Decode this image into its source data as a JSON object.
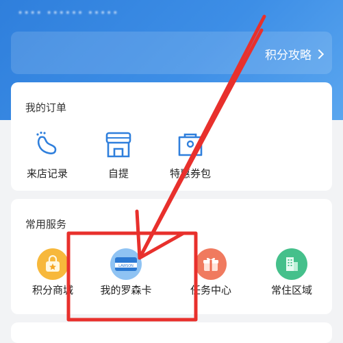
{
  "header": {
    "status_text": "•••• •••••• •••••",
    "points_link": "积分攻略"
  },
  "orders": {
    "title": "我的订单",
    "items": [
      {
        "label": "来店记录",
        "icon": "footprint-icon"
      },
      {
        "label": "自提",
        "icon": "store-icon"
      },
      {
        "label": "特惠券包",
        "icon": "coupon-bag-icon"
      }
    ]
  },
  "services": {
    "title": "常用服务",
    "items": [
      {
        "label": "积分商城",
        "icon": "shopping-bag-icon",
        "color": "#f5a623"
      },
      {
        "label": "我的罗森卡",
        "icon": "lawson-card-icon",
        "color": "#3f8fe0"
      },
      {
        "label": "任务中心",
        "icon": "gift-icon",
        "color": "#ef6a4f"
      },
      {
        "label": "常住区域",
        "icon": "building-icon",
        "color": "#3fbf87"
      }
    ],
    "card_logo_text": "LAWSON"
  },
  "colors": {
    "accent": "#3d8ee6",
    "annotation": "#e8302c"
  }
}
